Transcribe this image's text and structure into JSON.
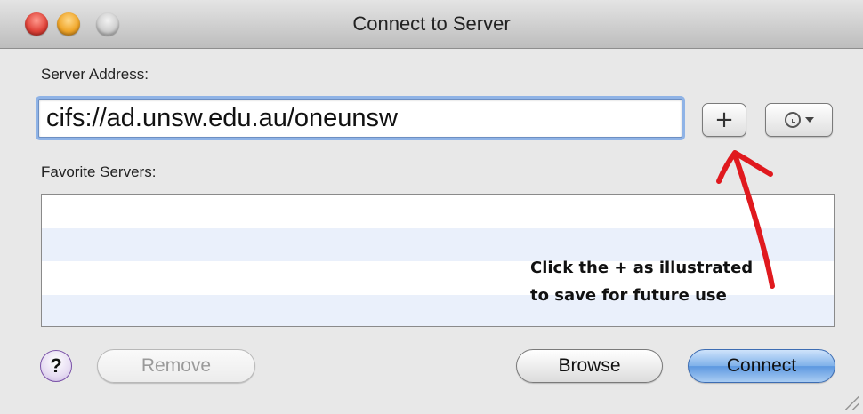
{
  "window": {
    "title": "Connect to Server"
  },
  "server_address": {
    "label": "Server Address:",
    "value": "cifs://ad.unsw.edu.au/oneunsw"
  },
  "buttons": {
    "add_label": "+",
    "help_label": "?",
    "remove_label": "Remove",
    "browse_label": "Browse",
    "connect_label": "Connect"
  },
  "favorites": {
    "label": "Favorite Servers:",
    "items": []
  },
  "annotation": {
    "line1": "Click the + as illustrated",
    "line2": "to save for future use",
    "arrow_color": "#e0191e"
  },
  "icons": {
    "recent_servers": "clock-icon",
    "dropdown": "chevron-down-icon"
  },
  "colors": {
    "close": "#e0443a",
    "minimize": "#f0a62a",
    "zoom": "#cfcfcf",
    "connect_button": "#5c98e0",
    "list_alt_row": "#eaf0fb"
  }
}
